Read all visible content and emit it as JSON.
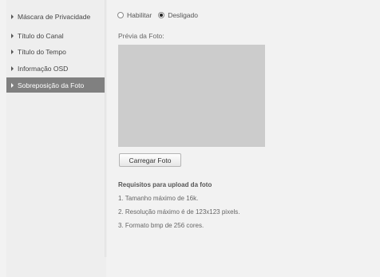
{
  "sidebar": {
    "items": [
      {
        "label": "Máscara de Privacidade",
        "active": false
      },
      {
        "label": "Título do Canal",
        "active": false
      },
      {
        "label": "Título do Tempo",
        "active": false
      },
      {
        "label": "Informação OSD",
        "active": false
      },
      {
        "label": "Sobreposição da Foto",
        "active": true
      }
    ]
  },
  "mode": {
    "options": [
      "Habilitar",
      "Desligado"
    ],
    "selected": "Desligado"
  },
  "preview": {
    "label": "Prévia da Foto:"
  },
  "upload_button": "Carregar Foto",
  "requirements": {
    "title": "Requisitos para upload da foto",
    "lines": [
      "1. Tamanho máximo de 16k.",
      "2. Resolução máximo é de 123x123 pixels.",
      "3. Formato bmp de 256 cores."
    ]
  },
  "colors": {
    "active_item_bg": "#808080",
    "preview_bg": "#cccccc"
  }
}
